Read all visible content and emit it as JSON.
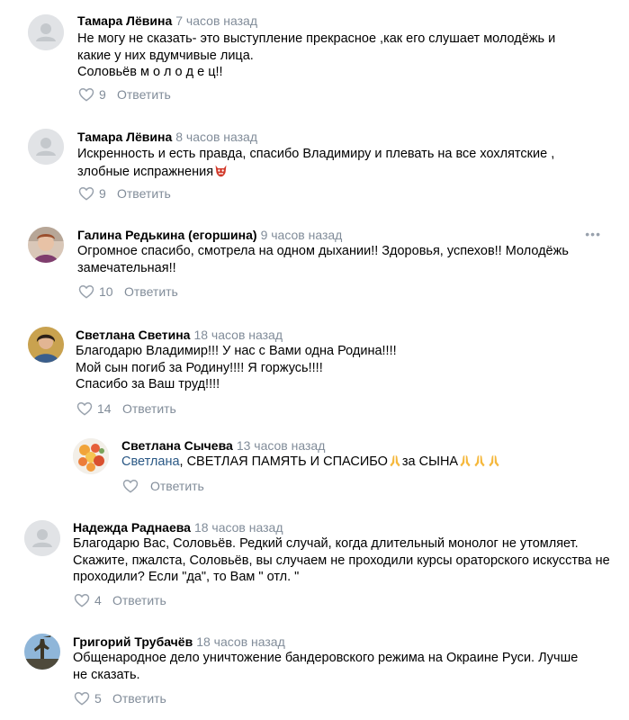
{
  "actions": {
    "reply_label": "Ответить"
  },
  "comments": [
    {
      "author": "Тамара Лёвина",
      "time": "7 часов назад",
      "lines": [
        "Не могу не сказать- это выступление прекрасное ,как его слушает молодёжь и",
        "какие у них вдумчивые лица.",
        "Соловьёв м о л о д е ц!!"
      ],
      "likes": "9",
      "avatar": "placeholder-avatar"
    },
    {
      "author": "Тамара Лёвина",
      "time": "8 часов назад",
      "lines": [
        "Искренность и есть правда, спасибо Владимиру и плевать на все хохлятские ,",
        "злобные испражнения"
      ],
      "emoji_after": "devil-mask-emoji",
      "likes": "9",
      "avatar": "placeholder-avatar"
    },
    {
      "author": "Галина Редькина (егоршина)",
      "time": "9 часов назад",
      "lines": [
        "Огромное спасибо, смотрела на одном дыхании!! Здоровья, успехов!! Молодёжь",
        "замечательная!!"
      ],
      "likes": "10",
      "avatar": "photo-avatar",
      "menu": "•••"
    },
    {
      "author": "Светлана Светина",
      "time": "18 часов назад",
      "lines": [
        "Благодарю Владимир!!! У нас с Вами одна Родина!!!!",
        "Мой сын погиб за Родину!!!! Я горжусь!!!!",
        "Спасибо за Ваш труд!!!!"
      ],
      "likes": "14",
      "avatar": "photo-avatar"
    },
    {
      "author": "Светлана Сычева",
      "time": "13 часов назад",
      "mention": "Светлана",
      "text_a": ", СВЕТЛАЯ ПАМЯТЬ И СПАСИБО",
      "text_b": "за СЫНА",
      "likes": "",
      "avatar": "flowers-photo-avatar",
      "is_reply": true
    },
    {
      "author": "Надежда Раднаева",
      "time": "18 часов назад",
      "lines": [
        "Благодарю Вас, Соловьёв. Редкий случай, когда длительный монолог не утомляет.",
        "Скажите, пжалста, Соловьёв, вы случаем не проходили курсы ораторского искусства не",
        "проходили? Если \"да\", то Вам \" отл. \""
      ],
      "likes": "4",
      "avatar": "placeholder-avatar"
    },
    {
      "author": "Григорий Трубачёв",
      "time": "18 часов назад",
      "lines": [
        "Общенародное дело уничтожение бандеровского режима на Окраине Руси. Лучше",
        "не сказать."
      ],
      "likes": "5",
      "avatar": "statue-photo-avatar"
    }
  ]
}
